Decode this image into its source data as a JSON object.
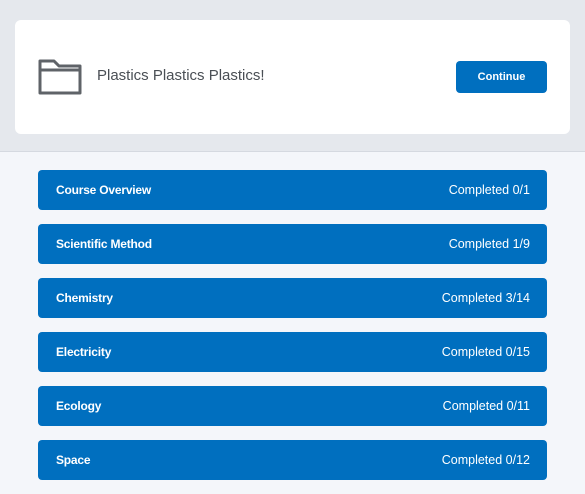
{
  "course": {
    "icon": "folder-icon",
    "title": "Plastics Plastics Plastics!",
    "continue_label": "Continue"
  },
  "colors": {
    "accent": "#006fbf",
    "band": "#e5e8ed",
    "background": "#f4f6fa",
    "card": "#ffffff"
  },
  "units": [
    {
      "name": "Course Overview",
      "progress": "Completed 0/1"
    },
    {
      "name": "Scientific Method",
      "progress": "Completed 1/9"
    },
    {
      "name": "Chemistry",
      "progress": "Completed 3/14"
    },
    {
      "name": "Electricity",
      "progress": "Completed 0/15"
    },
    {
      "name": "Ecology",
      "progress": "Completed 0/11"
    },
    {
      "name": "Space",
      "progress": "Completed 0/12"
    }
  ]
}
